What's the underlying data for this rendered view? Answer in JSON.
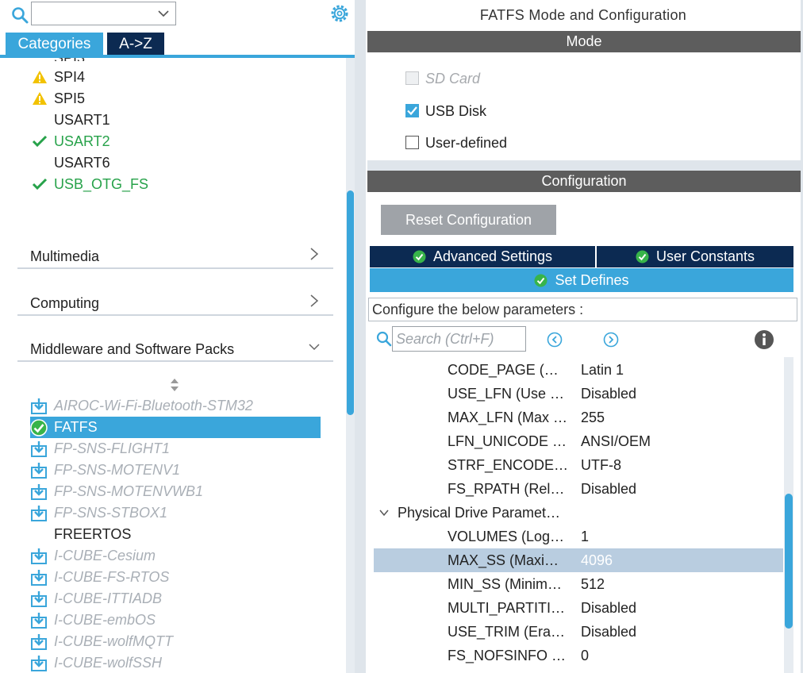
{
  "colors": {
    "accent": "#3aa6db",
    "navy": "#0c2a52",
    "warning": "#f2c200",
    "ok_green": "#27a24a",
    "section_gray": "#5d5d5d"
  },
  "left": {
    "tabs": {
      "categories": "Categories",
      "az": "A->Z"
    },
    "connectivity_items": [
      {
        "label": "SPI4",
        "icon": "warning-icon",
        "status": "warning"
      },
      {
        "label": "SPI5",
        "icon": "warning-icon",
        "status": "warning"
      },
      {
        "label": "USART1",
        "icon": "",
        "status": "none"
      },
      {
        "label": "USART2",
        "icon": "check-icon",
        "status": "ok"
      },
      {
        "label": "USART6",
        "icon": "",
        "status": "none"
      },
      {
        "label": "USB_OTG_FS",
        "icon": "check-icon",
        "status": "ok"
      }
    ],
    "categories": {
      "multimedia": "Multimedia",
      "computing": "Computing",
      "middleware": "Middleware and Software Packs"
    },
    "middleware_items": [
      {
        "label": "AIROC-Wi-Fi-Bluetooth-STM32",
        "type": "pack"
      },
      {
        "label": "FATFS",
        "type": "selected"
      },
      {
        "label": "FP-SNS-FLIGHT1",
        "type": "pack"
      },
      {
        "label": "FP-SNS-MOTENV1",
        "type": "pack"
      },
      {
        "label": "FP-SNS-MOTENVWB1",
        "type": "pack"
      },
      {
        "label": "FP-SNS-STBOX1",
        "type": "pack"
      },
      {
        "label": "FREERTOS",
        "type": "plain"
      },
      {
        "label": "I-CUBE-Cesium",
        "type": "pack"
      },
      {
        "label": "I-CUBE-FS-RTOS",
        "type": "pack"
      },
      {
        "label": "I-CUBE-ITTIADB",
        "type": "pack"
      },
      {
        "label": "I-CUBE-embOS",
        "type": "pack"
      },
      {
        "label": "I-CUBE-wolfMQTT",
        "type": "pack"
      },
      {
        "label": "I-CUBE-wolfSSH",
        "type": "pack"
      }
    ]
  },
  "right": {
    "title": "FATFS Mode and Configuration",
    "mode_header": "Mode",
    "mode_options": [
      {
        "label": "SD Card",
        "checked": false,
        "disabled": true
      },
      {
        "label": "USB Disk",
        "checked": true,
        "disabled": false
      },
      {
        "label": "User-defined",
        "checked": false,
        "disabled": false
      }
    ],
    "config_header": "Configuration",
    "reset_button": "Reset Configuration",
    "config_tabs": {
      "advanced": "Advanced Settings",
      "user_constants": "User Constants",
      "set_defines": "Set Defines"
    },
    "caption": "Configure the below parameters :",
    "search_placeholder": "Search (Ctrl+F)",
    "params_top": [
      {
        "name": "CODE_PAGE (…",
        "value": "Latin 1"
      },
      {
        "name": "USE_LFN (Use …",
        "value": "Disabled"
      },
      {
        "name": "MAX_LFN (Max …",
        "value": "255"
      },
      {
        "name": "LFN_UNICODE …",
        "value": "ANSI/OEM"
      },
      {
        "name": "STRF_ENCODE…",
        "value": "UTF-8"
      },
      {
        "name": "FS_RPATH (Rel…",
        "value": "Disabled"
      }
    ],
    "group_label": "Physical Drive Paramet…",
    "params_group": [
      {
        "name": "VOLUMES (Log…",
        "value": "1",
        "selected": false
      },
      {
        "name": "MAX_SS (Maxi…",
        "value": "4096",
        "selected": true
      },
      {
        "name": "MIN_SS (Minim…",
        "value": "512",
        "selected": false
      },
      {
        "name": "MULTI_PARTITI…",
        "value": "Disabled",
        "selected": false
      },
      {
        "name": "USE_TRIM (Era…",
        "value": "Disabled",
        "selected": false
      },
      {
        "name": "FS_NOFSINFO …",
        "value": "0",
        "selected": false
      }
    ]
  }
}
